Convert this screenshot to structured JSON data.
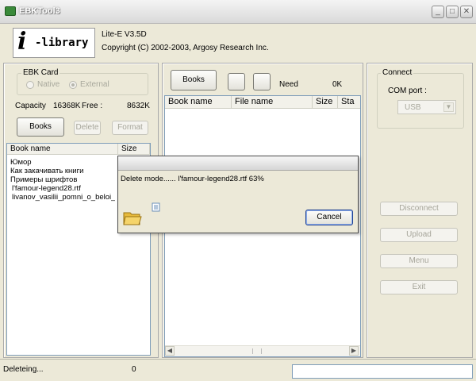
{
  "window": {
    "title": "EBKTool3"
  },
  "header": {
    "logo": {
      "i": "i",
      "text": "-library"
    },
    "version": "Lite-E V3.5D",
    "copyright": "Copyright (C) 2002-2003, Argosy Research Inc."
  },
  "ebk_card": {
    "title": "EBK Card",
    "native_label": "Native",
    "external_label": "External",
    "selected": "External",
    "capacity_label": "Capacity",
    "capacity_value": "16368K",
    "free_label": "Free :",
    "free_value": "8632K",
    "buttons": {
      "books": "Books",
      "delete": "Delete",
      "format": "Format"
    }
  },
  "left_list": {
    "columns": [
      "Book name",
      "Size"
    ],
    "rows": [
      "Юмор",
      "Как закачивать книги",
      "Примеры шрифтов",
      "l'famour-legend28.rtf",
      "livanov_vasilii_pomni_o_beloi_v"
    ]
  },
  "middle": {
    "books_button": "Books",
    "need_label": "Need",
    "need_value": "0K",
    "columns": [
      "Book name",
      "File name",
      "Size",
      "Sta"
    ]
  },
  "connect": {
    "title": "Connect",
    "com_port_label": "COM port :",
    "com_port_value": "USB",
    "buttons": {
      "disconnect": "Disconnect",
      "upload": "Upload",
      "menu": "Menu",
      "exit": "Exit"
    }
  },
  "status": {
    "text": "Deleteing...",
    "count": "0"
  },
  "dialog": {
    "message": "Delete mode...... l'famour-legend28.rtf 63%",
    "cancel_label": "Cancel"
  },
  "colors": {
    "accent_border": "#7f9db9",
    "logo_dot": "#c98a00"
  }
}
